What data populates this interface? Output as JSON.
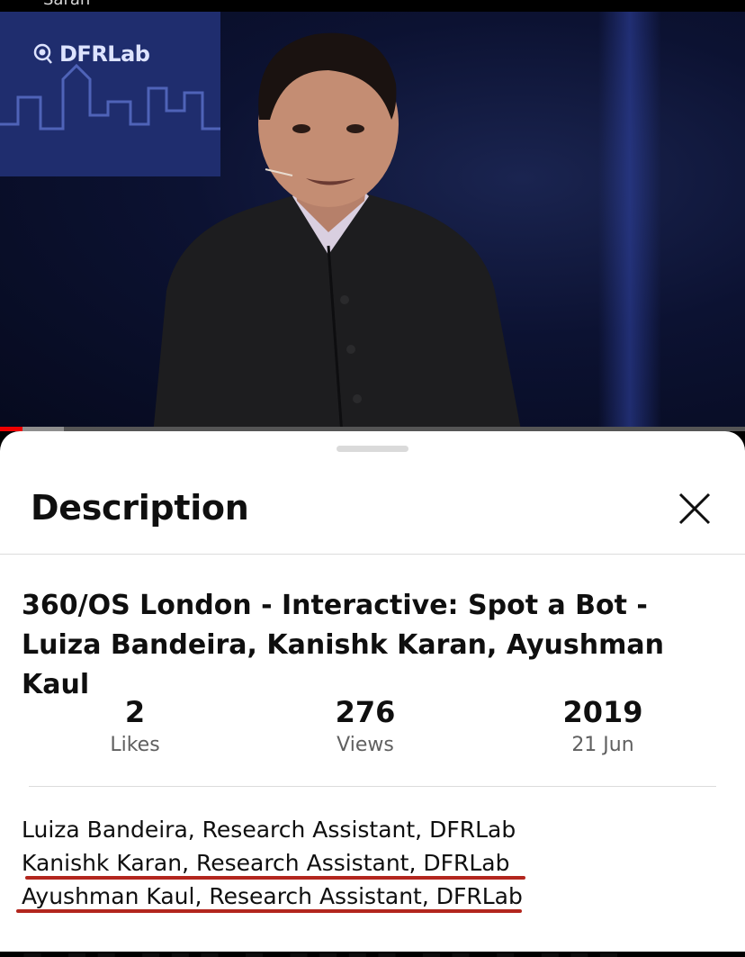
{
  "top_strip": {
    "text": "Saran"
  },
  "video": {
    "logo_text": "DFRLab",
    "progress": 0.03,
    "buffered": 0.085
  },
  "sheet": {
    "title": "Description",
    "close_icon": "close-icon"
  },
  "details": {
    "video_title": "360/OS London - Interactive: Spot a Bot - Luiza Bandeira, Kanishk Karan, Ayushman Kaul",
    "stats": [
      {
        "value": "2",
        "label": "Likes"
      },
      {
        "value": "276",
        "label": "Views"
      },
      {
        "value": "2019",
        "label": "21 Jun"
      }
    ],
    "description_lines": [
      "Luiza Bandeira, Research Assistant, DFRLab",
      "Kanishk Karan, Research Assistant, DFRLab",
      "Ayushman Kaul, Research Assistant, DFRLab"
    ]
  },
  "colors": {
    "underline": "#b3261e",
    "progress_played": "#ee0000",
    "sheet_background": "#ffffff"
  }
}
